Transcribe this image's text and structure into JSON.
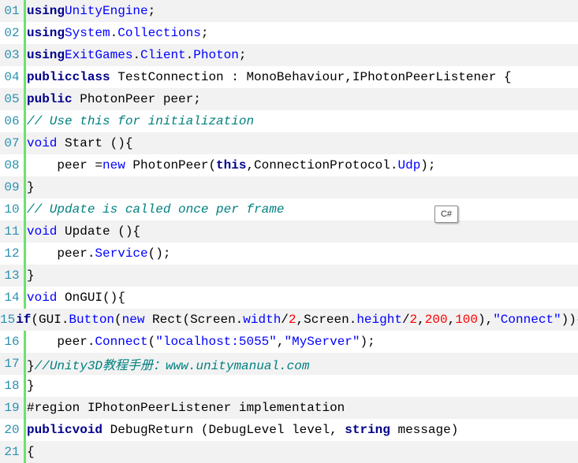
{
  "code_block": {
    "language_badge": "C#",
    "lines": [
      {
        "num": "01",
        "parts": [
          {
            "t": "using",
            "c": "kw"
          },
          {
            "t": "UnityEngine",
            "c": "fn"
          },
          {
            "t": ";",
            "c": ""
          }
        ]
      },
      {
        "num": "02",
        "parts": [
          {
            "t": "using",
            "c": "kw"
          },
          {
            "t": "System",
            "c": "fn"
          },
          {
            "t": ".",
            "c": ""
          },
          {
            "t": "Collections",
            "c": "fn"
          },
          {
            "t": ";",
            "c": ""
          }
        ]
      },
      {
        "num": "03",
        "parts": [
          {
            "t": "using",
            "c": "kw"
          },
          {
            "t": "ExitGames",
            "c": "fn"
          },
          {
            "t": ".",
            "c": ""
          },
          {
            "t": "Client",
            "c": "fn"
          },
          {
            "t": ".",
            "c": ""
          },
          {
            "t": "Photon",
            "c": "fn"
          },
          {
            "t": ";",
            "c": ""
          }
        ]
      },
      {
        "num": "04",
        "parts": [
          {
            "t": "public",
            "c": "kw"
          },
          {
            "t": "class",
            "c": "kw"
          },
          {
            "t": " TestConnection : MonoBehaviour,IPhotonPeerListener {",
            "c": ""
          }
        ]
      },
      {
        "num": "05",
        "parts": [
          {
            "t": "public",
            "c": "kw"
          },
          {
            "t": " PhotonPeer peer;",
            "c": ""
          }
        ]
      },
      {
        "num": "06",
        "parts": [
          {
            "t": "// Use this for initialization",
            "c": "comment"
          }
        ]
      },
      {
        "num": "07",
        "parts": [
          {
            "t": "void",
            "c": "kw2"
          },
          {
            "t": " Start ()",
            "c": ""
          },
          {
            "t": "{",
            "c": ""
          }
        ]
      },
      {
        "num": "08",
        "parts": [
          {
            "t": "    peer =",
            "c": ""
          },
          {
            "t": "new",
            "c": "kw2"
          },
          {
            "t": " PhotonPeer(",
            "c": ""
          },
          {
            "t": "this",
            "c": "kw"
          },
          {
            "t": ",ConnectionProtocol.",
            "c": ""
          },
          {
            "t": "Udp",
            "c": "prop"
          },
          {
            "t": ");",
            "c": ""
          }
        ]
      },
      {
        "num": "09",
        "parts": [
          {
            "t": "}",
            "c": ""
          }
        ]
      },
      {
        "num": "10",
        "parts": [
          {
            "t": "// Update is called once per frame",
            "c": "comment"
          }
        ]
      },
      {
        "num": "11",
        "parts": [
          {
            "t": "void",
            "c": "kw2"
          },
          {
            "t": " Update ()",
            "c": ""
          },
          {
            "t": "{",
            "c": ""
          }
        ]
      },
      {
        "num": "12",
        "parts": [
          {
            "t": "    peer.",
            "c": ""
          },
          {
            "t": "Service",
            "c": "prop"
          },
          {
            "t": "();",
            "c": ""
          }
        ]
      },
      {
        "num": "13",
        "parts": [
          {
            "t": "}",
            "c": ""
          }
        ]
      },
      {
        "num": "14",
        "parts": [
          {
            "t": "void",
            "c": "kw2"
          },
          {
            "t": " OnGUI()",
            "c": ""
          },
          {
            "t": "{",
            "c": ""
          }
        ]
      },
      {
        "num": "15",
        "parts": [
          {
            "t": "if",
            "c": "kw"
          },
          {
            "t": "(GUI.",
            "c": ""
          },
          {
            "t": "Button",
            "c": "prop"
          },
          {
            "t": "(",
            "c": ""
          },
          {
            "t": "new",
            "c": "kw2"
          },
          {
            "t": " Rect(Screen.",
            "c": ""
          },
          {
            "t": "width",
            "c": "prop"
          },
          {
            "t": "/",
            "c": ""
          },
          {
            "t": "2",
            "c": "num"
          },
          {
            "t": ",Screen.",
            "c": ""
          },
          {
            "t": "height",
            "c": "prop"
          },
          {
            "t": "/",
            "c": ""
          },
          {
            "t": "2",
            "c": "num"
          },
          {
            "t": ",",
            "c": ""
          },
          {
            "t": "200",
            "c": "num"
          },
          {
            "t": ",",
            "c": ""
          },
          {
            "t": "100",
            "c": "num"
          },
          {
            "t": "),",
            "c": ""
          },
          {
            "t": "\"Connect\"",
            "c": "str"
          },
          {
            "t": ")){",
            "c": ""
          }
        ]
      },
      {
        "num": "16",
        "parts": [
          {
            "t": "    peer.",
            "c": ""
          },
          {
            "t": "Connect",
            "c": "prop"
          },
          {
            "t": "(",
            "c": ""
          },
          {
            "t": "\"localhost:5055\"",
            "c": "str"
          },
          {
            "t": ",",
            "c": ""
          },
          {
            "t": "\"MyServer\"",
            "c": "str"
          },
          {
            "t": ");",
            "c": ""
          }
        ]
      },
      {
        "num": "17",
        "parts": [
          {
            "t": "}",
            "c": ""
          },
          {
            "t": "//Unity3D教程手册：www.unitymanual.com",
            "c": "comment"
          }
        ]
      },
      {
        "num": "18",
        "parts": [
          {
            "t": "}",
            "c": ""
          }
        ]
      },
      {
        "num": "19",
        "parts": [
          {
            "t": "#region IPhotonPeerListener implementation",
            "c": "region"
          }
        ]
      },
      {
        "num": "20",
        "parts": [
          {
            "t": "public",
            "c": "kw"
          },
          {
            "t": "void",
            "c": "kw"
          },
          {
            "t": " DebugReturn (DebugLevel level, ",
            "c": ""
          },
          {
            "t": "string",
            "c": "kw"
          },
          {
            "t": " message)",
            "c": ""
          }
        ]
      },
      {
        "num": "21",
        "parts": [
          {
            "t": "{",
            "c": ""
          }
        ]
      }
    ]
  }
}
